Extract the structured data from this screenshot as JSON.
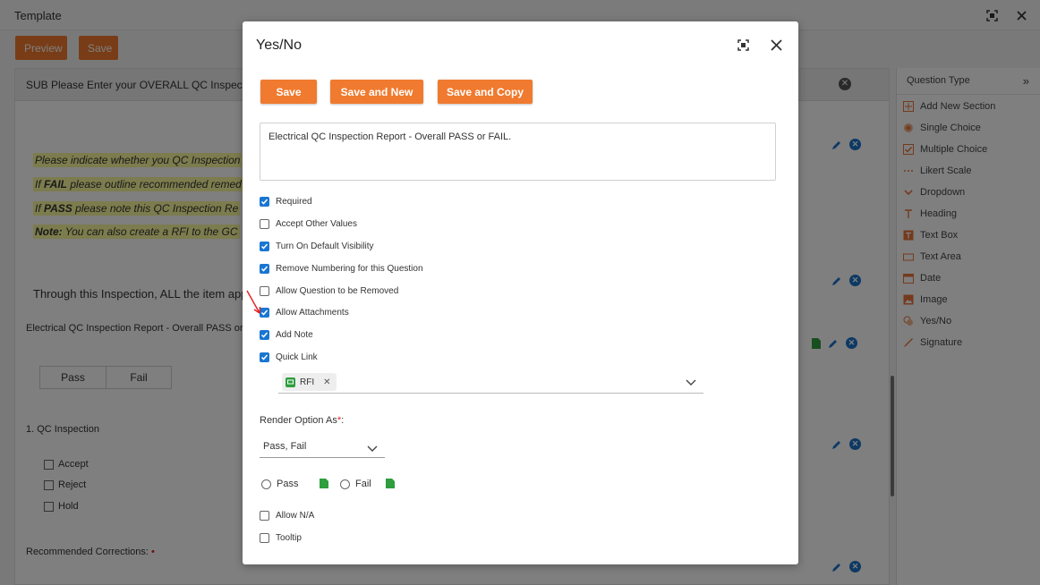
{
  "app": {
    "title": "Template",
    "preview_label": "Preview",
    "save_label": "Save",
    "sub_heading": "SUB Please Enter your OVERALL QC Inspection",
    "highlight_lines": [
      {
        "bold": "",
        "text": "Please indicate whether you QC Inspection"
      },
      {
        "bold": "FAIL",
        "prefix": "If ",
        "text": " please outline recommended remed"
      },
      {
        "bold": "PASS",
        "prefix": "If ",
        "text": " please note this QC Inspection Re"
      },
      {
        "bold": "Note:",
        "prefix": "",
        "text": " You can also create a RFI to the GC"
      }
    ],
    "through_text": "Through this Inspection, ALL the item appe",
    "report_text": "Electrical QC Inspection Report - Overall PASS or",
    "pass_fail": [
      "Pass",
      "Fail"
    ],
    "qc_heading": "1. QC Inspection",
    "qc_options": [
      "Accept",
      "Reject",
      "Hold"
    ],
    "recommended": "Recommended Corrections:",
    "required_mark": "•"
  },
  "sidebar": {
    "title": "Question Type",
    "items": [
      {
        "label": "Add New Section",
        "icon": "add-section-icon",
        "color": "#e8743b"
      },
      {
        "label": "Single Choice",
        "icon": "radio-icon",
        "color": "#e8743b"
      },
      {
        "label": "Multiple Choice",
        "icon": "checkbox-icon",
        "color": "#e8743b"
      },
      {
        "label": "Likert Scale",
        "icon": "likert-icon",
        "color": "#e8743b"
      },
      {
        "label": "Dropdown",
        "icon": "chevron-down-icon",
        "color": "#e8743b"
      },
      {
        "label": "Heading",
        "icon": "heading-icon",
        "color": "#e8743b"
      },
      {
        "label": "Text Box",
        "icon": "textbox-icon",
        "color": "#e8743b"
      },
      {
        "label": "Text Area",
        "icon": "textarea-icon",
        "color": "#e8743b"
      },
      {
        "label": "Date",
        "icon": "calendar-icon",
        "color": "#e8743b"
      },
      {
        "label": "Image",
        "icon": "image-icon",
        "color": "#e8743b"
      },
      {
        "label": "Yes/No",
        "icon": "yes-no-icon",
        "color": "#e8743b"
      },
      {
        "label": "Signature",
        "icon": "signature-icon",
        "color": "#e8743b"
      }
    ]
  },
  "modal": {
    "title": "Yes/No",
    "buttons": {
      "save": "Save",
      "save_new": "Save and New",
      "save_copy": "Save and Copy"
    },
    "question_text": "Electrical QC Inspection Report - Overall PASS or FAIL.",
    "options": [
      {
        "label": "Required",
        "checked": true
      },
      {
        "label": "Accept Other Values",
        "checked": false
      },
      {
        "label": "Turn On Default Visibility",
        "checked": true
      },
      {
        "label": "Remove Numbering for this Question",
        "checked": true
      },
      {
        "label": "Allow Question to be Removed",
        "checked": false
      },
      {
        "label": "Allow Attachments",
        "checked": true
      },
      {
        "label": "Add Note",
        "checked": true
      },
      {
        "label": "Quick Link",
        "checked": true
      }
    ],
    "quick_link_chip": "RFI",
    "render_label": "Render Option As",
    "render_required": "*",
    "render_value": "Pass, Fail",
    "radio_options": [
      "Pass",
      "Fail"
    ],
    "extra_options": [
      {
        "label": "Allow N/A",
        "checked": false
      },
      {
        "label": "Tooltip",
        "checked": false
      }
    ]
  },
  "colors": {
    "accent": "#f07a2f",
    "checkbox": "#1976d2",
    "action_icon": "#1a73c9",
    "green_icon": "#2e9e3e"
  }
}
